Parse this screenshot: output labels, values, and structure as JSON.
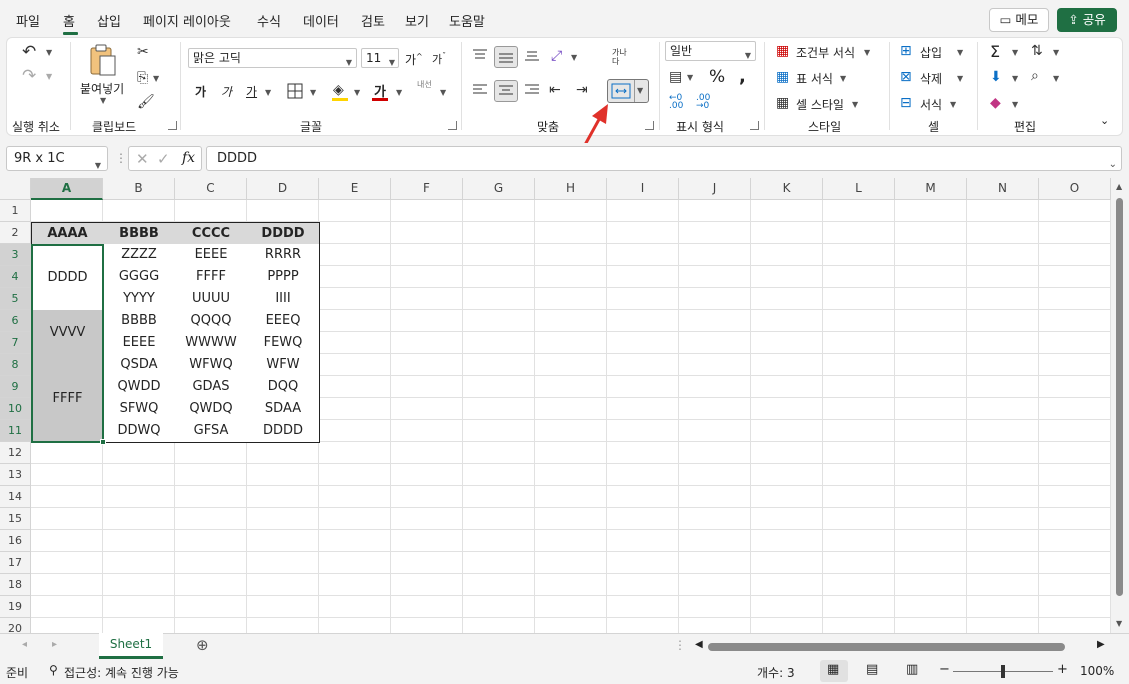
{
  "menu": {
    "tabs": [
      "파일",
      "홈",
      "삽입",
      "페이지 레이아웃",
      "수식",
      "데이터",
      "검토",
      "보기",
      "도움말"
    ],
    "active_tab": "홈",
    "memo_label": "메모",
    "share_label": "공유"
  },
  "ribbon": {
    "groups": {
      "undo": "실행 취소",
      "clipboard": "클립보드",
      "font": "글꼴",
      "alignment": "맞춤",
      "number": "표시 형식",
      "styles": "스타일",
      "cells": "셀",
      "editing": "편집"
    },
    "paste_label": "붙여넣기",
    "font_name": "맑은 고딕",
    "font_size": "11",
    "bold": "가",
    "italic": "가",
    "underline": "가",
    "grow_font": "가",
    "shrink_font": "가",
    "font_color_glyph": "가",
    "phonetic": "내선",
    "wrap_text": "가나다",
    "number_format": "일반",
    "conditional_format": "조건부 서식",
    "format_as_table": "표 서식",
    "cell_styles": "셀 스타일",
    "insert": "삽입",
    "delete": "삭제",
    "format": "서식"
  },
  "formula_bar": {
    "name_box": "9R x 1C",
    "fx_label": "fx",
    "content": "DDDD"
  },
  "columns": [
    "A",
    "B",
    "C",
    "D",
    "E",
    "F",
    "G",
    "H",
    "I",
    "J",
    "K",
    "L",
    "M",
    "N",
    "O"
  ],
  "rows": [
    "1",
    "2",
    "3",
    "4",
    "5",
    "6",
    "7",
    "8",
    "9",
    "10",
    "11",
    "12",
    "13",
    "14",
    "15",
    "16",
    "17",
    "18",
    "19",
    "20"
  ],
  "table": {
    "headers": [
      "AAAA",
      "BBBB",
      "CCCC",
      "DDDD"
    ],
    "merged_a": [
      {
        "text": "DDDD",
        "shaded": false
      },
      {
        "text": "VVVV",
        "shaded": true
      },
      {
        "text": "FFFF",
        "shaded": true
      }
    ],
    "rows": [
      [
        "ZZZZ",
        "EEEE",
        "RRRR"
      ],
      [
        "GGGG",
        "FFFF",
        "PPPP"
      ],
      [
        "YYYY",
        "UUUU",
        "IIII"
      ],
      [
        "BBBB",
        "QQQQ",
        "EEEQ"
      ],
      [
        "EEEE",
        "WWWW",
        "FEWQ"
      ],
      [
        "QSDA",
        "WFWQ",
        "WFW"
      ],
      [
        "QWDD",
        "GDAS",
        "DQQ"
      ],
      [
        "SFWQ",
        "QWDQ",
        "SDAA"
      ],
      [
        "DDWQ",
        "GFSA",
        "DDDD"
      ]
    ]
  },
  "sheet_tab": "Sheet1",
  "status": {
    "ready": "준비",
    "accessibility": "접근성: 계속 진행 가능",
    "count": "개수: 3",
    "zoom": "100%"
  },
  "colors": {
    "accent": "#1f6f43",
    "arrow": "#e0312a",
    "header_fill": "#d9d9d9",
    "merged_fill": "#c8c8c8"
  }
}
